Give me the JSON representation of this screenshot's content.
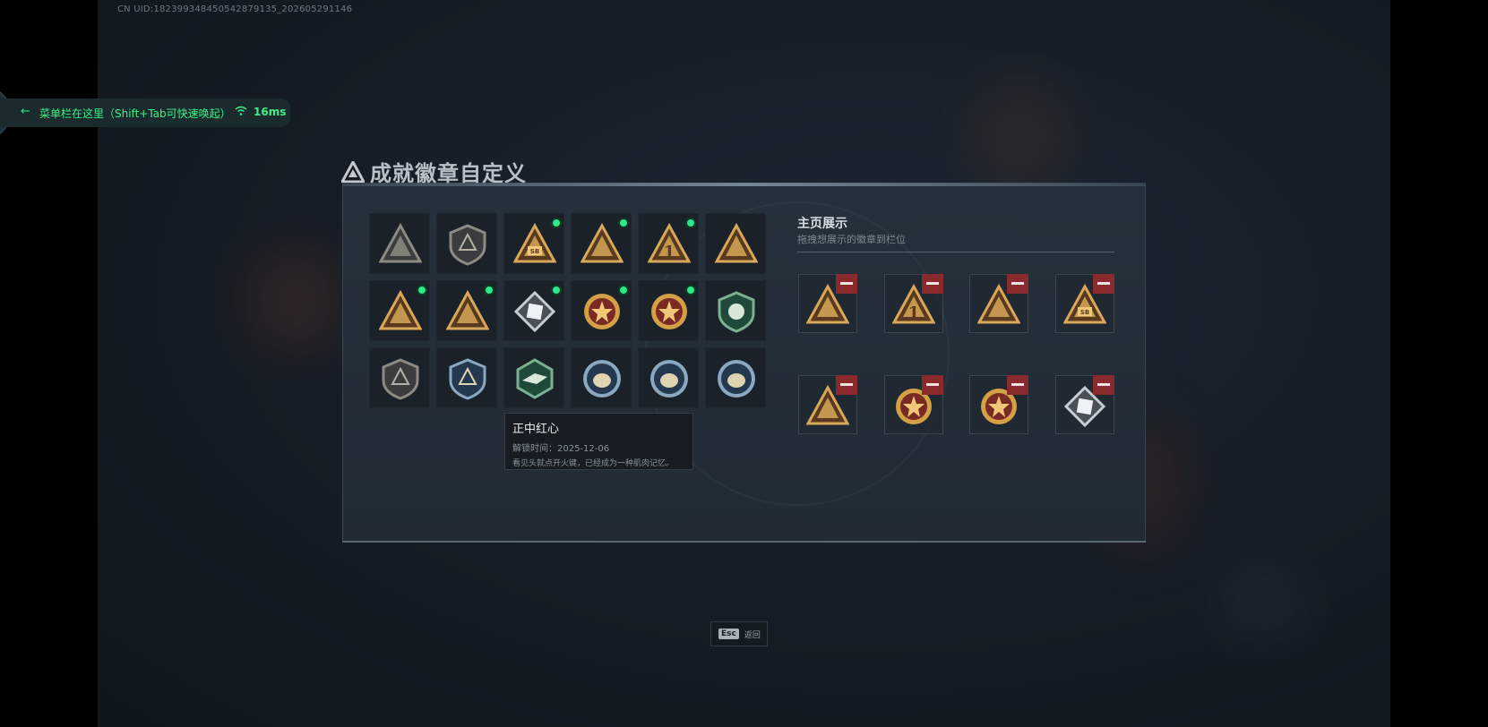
{
  "uid_text": "CN UID:182399348450542879135_202605291146",
  "menu": {
    "arrow": "←",
    "text": "菜单栏在这里（Shift+Tab可快速唤起）",
    "ping": "16ms",
    "icon": "wifi-icon",
    "accent": "#3ff08a"
  },
  "panel": {
    "title": "成就徽章自定义",
    "title_icon": "triangle-logo-icon"
  },
  "badges": [
    {
      "icon": "triangle-shield-badge",
      "new": false,
      "tone": "grey"
    },
    {
      "icon": "helicopter-shield-badge",
      "new": false,
      "tone": "grey"
    },
    {
      "icon": "triangle-sb-badge",
      "new": true,
      "tone": "gold"
    },
    {
      "icon": "triangle-soldier-badge",
      "new": true,
      "tone": "gold"
    },
    {
      "icon": "triangle-number-one-badge",
      "new": true,
      "tone": "gold"
    },
    {
      "icon": "triangle-bottle-badge",
      "new": false,
      "tone": "gold"
    },
    {
      "icon": "triangle-skull-badge",
      "new": true,
      "tone": "gold"
    },
    {
      "icon": "triangle-beast-badge",
      "new": true,
      "tone": "gold"
    },
    {
      "icon": "silver-diamond-badge",
      "new": true,
      "tone": "silver"
    },
    {
      "icon": "red-star-medal-badge",
      "new": true,
      "tone": "red"
    },
    {
      "icon": "crest-medal-badge",
      "new": true,
      "tone": "red"
    },
    {
      "icon": "green-shield-badge",
      "new": false,
      "tone": "green"
    },
    {
      "icon": "rifle-shield-badge",
      "new": false,
      "tone": "grey"
    },
    {
      "icon": "blue-wing-shield-badge",
      "new": false,
      "tone": "blue"
    },
    {
      "icon": "green-hex-bird-badge",
      "new": false,
      "tone": "green"
    },
    {
      "icon": "round-beast-badge-1",
      "new": false,
      "tone": "blue"
    },
    {
      "icon": "round-beast-badge-2",
      "new": false,
      "tone": "blue"
    },
    {
      "icon": "round-ball-badge",
      "new": false,
      "tone": "blue"
    }
  ],
  "showcase": {
    "title": "主页展示",
    "subtitle": "拖拽想展示的徽章到栏位",
    "slots": [
      {
        "icon": "triangle-skull-badge",
        "tone": "gold"
      },
      {
        "icon": "triangle-number-one-badge",
        "tone": "gold"
      },
      {
        "icon": "triangle-soldier-badge",
        "tone": "gold"
      },
      {
        "icon": "triangle-sb-badge",
        "tone": "gold"
      },
      {
        "icon": "triangle-beast-badge",
        "tone": "gold"
      },
      {
        "icon": "red-star-medal-badge",
        "tone": "red"
      },
      {
        "icon": "crest-medal-badge",
        "tone": "red"
      },
      {
        "icon": "silver-diamond-badge",
        "tone": "silver"
      }
    ]
  },
  "tooltip": {
    "title": "正中红心",
    "time": "解锁时间：2025-12-06",
    "desc": "看见头就点开火键，已经成为一种肌肉记忆。"
  },
  "esc": {
    "key": "Esc",
    "label": "返回"
  }
}
